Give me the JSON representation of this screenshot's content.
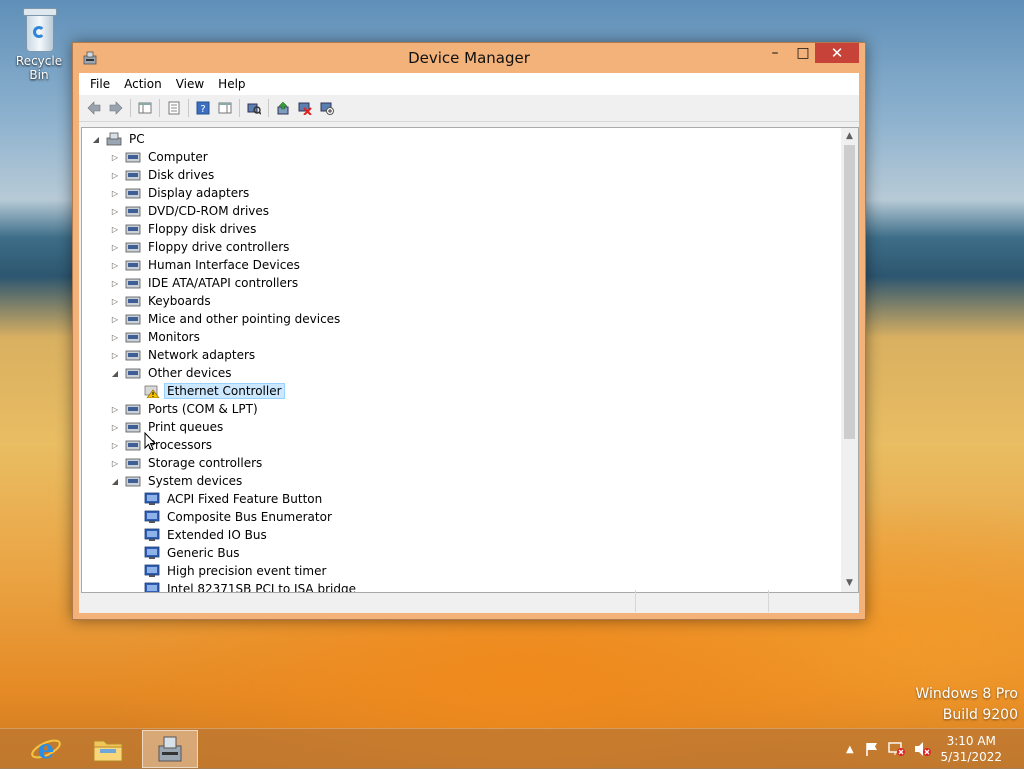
{
  "desktop": {
    "recycle_bin_label": "Recycle Bin",
    "watermark_line1": "Windows 8 Pro",
    "watermark_line2": "Build 9200"
  },
  "window": {
    "title": "Device Manager",
    "controls": {
      "minimize": "–",
      "maximize": "□",
      "close": "✕"
    }
  },
  "menu": [
    "File",
    "Action",
    "View",
    "Help"
  ],
  "tree": {
    "root": "PC",
    "categories": [
      "Computer",
      "Disk drives",
      "Display adapters",
      "DVD/CD-ROM drives",
      "Floppy disk drives",
      "Floppy drive controllers",
      "Human Interface Devices",
      "IDE ATA/ATAPI controllers",
      "Keyboards",
      "Mice and other pointing devices",
      "Monitors",
      "Network adapters",
      "Other devices",
      "Ports (COM & LPT)",
      "Print queues",
      "Processors",
      "Storage controllers",
      "System devices"
    ],
    "other_devices_children": [
      "Ethernet Controller"
    ],
    "system_devices_children": [
      "ACPI Fixed Feature Button",
      "Composite Bus Enumerator",
      "Extended IO Bus",
      "Generic Bus",
      "High precision event timer",
      "Intel 82371SB PCI to ISA bridge"
    ],
    "selected": "Ethernet Controller"
  },
  "taskbar": {
    "time": "3:10 AM",
    "date": "5/31/2022"
  },
  "colors": {
    "window_frame": "#f2b27a",
    "close_button": "#c7433a",
    "selection_bg": "#cce8ff",
    "selection_border": "#99d1ff"
  }
}
